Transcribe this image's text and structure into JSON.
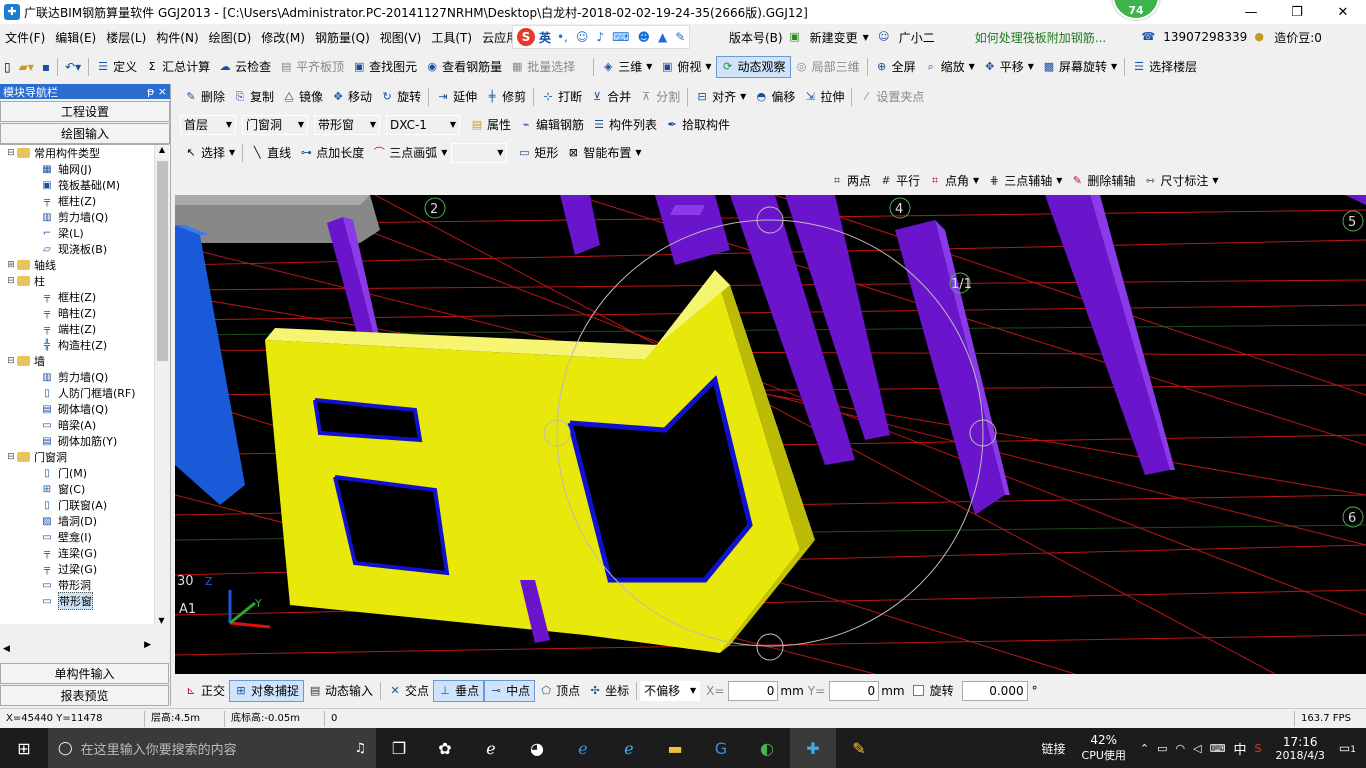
{
  "window": {
    "title": "广联达BIM钢筋算量软件 GGJ2013 - [C:\\Users\\Administrator.PC-20141127NRHM\\Desktop\\白龙村-2018-02-02-19-24-35(2666版).GGJ12]",
    "badge": "74",
    "minimize": "—",
    "restore": "❐",
    "close": "✕"
  },
  "menu": {
    "items": [
      "文件(F)",
      "编辑(E)",
      "楼层(L)",
      "构件(N)",
      "绘图(D)",
      "修改(M)",
      "钢筋量(Q)",
      "视图(V)",
      "工具(T)",
      "云应用"
    ],
    "ime_label": "英",
    "version": "版本号(B)",
    "new_change": "新建变更",
    "assistant": "广小二",
    "question": "如何处理筏板附加钢筋...",
    "phone": "13907298339",
    "price_beans": "造价豆:0"
  },
  "toolbar1": {
    "define": "定义",
    "sum": "汇总计算",
    "cloud_check": "云检查",
    "flat_top": "平齐板顶",
    "find": "查找图元",
    "view_rebar": "查看钢筋量",
    "batch_select": "批量选择",
    "three_d": "三维",
    "top_view": "俯视",
    "dynamic_view": "动态观察",
    "local_3d": "局部三维",
    "fullscreen": "全屏",
    "zoom": "缩放",
    "pan": "平移",
    "screen_rotate": "屏幕旋转",
    "select_floor": "选择楼层"
  },
  "sidebar": {
    "header": "模块导航栏",
    "pin": "ᵽ",
    "close": "×",
    "project_settings": "工程设置",
    "drawing_input": "绘图输入",
    "single_input": "单构件输入",
    "report_preview": "报表预览",
    "tree": [
      {
        "level": 0,
        "exp": "⊟",
        "icon": "folder",
        "label": "常用构件类型"
      },
      {
        "level": 1,
        "exp": "",
        "icon": "▦",
        "label": "轴网(J)"
      },
      {
        "level": 1,
        "exp": "",
        "icon": "▣",
        "label": "筏板基础(M)"
      },
      {
        "level": 1,
        "exp": "",
        "icon": "╤",
        "label": "框柱(Z)"
      },
      {
        "level": 1,
        "exp": "",
        "icon": "▥",
        "label": "剪力墙(Q)"
      },
      {
        "level": 1,
        "exp": "",
        "icon": "⌐",
        "label": "梁(L)"
      },
      {
        "level": 1,
        "exp": "",
        "icon": "▱",
        "label": "现浇板(B)"
      },
      {
        "level": 0,
        "exp": "⊞",
        "icon": "folder",
        "label": "轴线"
      },
      {
        "level": 0,
        "exp": "⊟",
        "icon": "folder",
        "label": "柱"
      },
      {
        "level": 1,
        "exp": "",
        "icon": "╤",
        "label": "框柱(Z)"
      },
      {
        "level": 1,
        "exp": "",
        "icon": "╤",
        "label": "暗柱(Z)"
      },
      {
        "level": 1,
        "exp": "",
        "icon": "╤",
        "label": "端柱(Z)"
      },
      {
        "level": 1,
        "exp": "",
        "icon": "╬",
        "label": "构造柱(Z)"
      },
      {
        "level": 0,
        "exp": "⊟",
        "icon": "folder",
        "label": "墙"
      },
      {
        "level": 1,
        "exp": "",
        "icon": "▥",
        "label": "剪力墙(Q)"
      },
      {
        "level": 1,
        "exp": "",
        "icon": "▯",
        "label": "人防门框墙(RF)"
      },
      {
        "level": 1,
        "exp": "",
        "icon": "▤",
        "label": "砌体墙(Q)"
      },
      {
        "level": 1,
        "exp": "",
        "icon": "▭",
        "label": "暗梁(A)"
      },
      {
        "level": 1,
        "exp": "",
        "icon": "▤",
        "label": "砌体加筋(Y)"
      },
      {
        "level": 0,
        "exp": "⊟",
        "icon": "folder",
        "label": "门窗洞"
      },
      {
        "level": 1,
        "exp": "",
        "icon": "▯",
        "label": "门(M)"
      },
      {
        "level": 1,
        "exp": "",
        "icon": "⊞",
        "label": "窗(C)"
      },
      {
        "level": 1,
        "exp": "",
        "icon": "▯",
        "label": "门联窗(A)"
      },
      {
        "level": 1,
        "exp": "",
        "icon": "▨",
        "label": "墙洞(D)"
      },
      {
        "level": 1,
        "exp": "",
        "icon": "▭",
        "label": "壁龛(I)"
      },
      {
        "level": 1,
        "exp": "",
        "icon": "╤",
        "label": "连梁(G)"
      },
      {
        "level": 1,
        "exp": "",
        "icon": "╤",
        "label": "过梁(G)"
      },
      {
        "level": 1,
        "exp": "",
        "icon": "▭",
        "label": "带形洞"
      },
      {
        "level": 1,
        "exp": "",
        "icon": "▭",
        "label": "带形窗",
        "selected": true
      }
    ]
  },
  "toolbar2": {
    "delete": "删除",
    "copy": "复制",
    "mirror": "镜像",
    "move": "移动",
    "rotate": "旋转",
    "extend": "延伸",
    "trim": "修剪",
    "break": "打断",
    "merge": "合并",
    "split": "分割",
    "align": "对齐",
    "offset": "偏移",
    "stretch": "拉伸",
    "set_grip": "设置夹点"
  },
  "toolbar3": {
    "floor": "首层",
    "category": "门窗洞",
    "type": "带形窗",
    "component": "DXC-1",
    "properties": "属性",
    "edit_rebar": "编辑钢筋",
    "component_list": "构件列表",
    "pick_component": "拾取构件"
  },
  "toolbar4": {
    "select": "选择",
    "line": "直线",
    "point_length": "点加长度",
    "three_point_arc": "三点画弧",
    "rect": "矩形",
    "smart_layout": "智能布置"
  },
  "toolbar5": {
    "two_points": "两点",
    "parallel": "平行",
    "point_angle": "点角",
    "three_point_axis": "三点辅轴",
    "delete_axis": "删除辅轴",
    "dimension": "尺寸标注"
  },
  "canvas": {
    "grid_labels": [
      "2",
      "4",
      "5",
      "6",
      "1/1",
      "A1",
      "30"
    ],
    "axis_z": "Z",
    "axis_y": "Y"
  },
  "snapbar": {
    "ortho": "正交",
    "object_snap": "对象捕捉",
    "dynamic_input": "动态输入",
    "intersection": "交点",
    "perpendicular": "垂点",
    "midpoint": "中点",
    "vertex": "顶点",
    "coordinate": "坐标",
    "offset_mode": "不偏移",
    "x_label": "X=",
    "x_value": "0",
    "y_label": "Y=",
    "y_value": "0",
    "mm1": "mm",
    "mm2": "mm",
    "rotate_label": "旋转",
    "rotate_value": "0.000",
    "degree": "°"
  },
  "statusbar": {
    "coords": "X=45440 Y=11478",
    "floor_height": "层高:4.5m",
    "bottom_elev": "底标高:-0.05m",
    "zero": "0",
    "fps": "163.7 FPS"
  },
  "taskbar": {
    "search_placeholder": "在这里输入你要搜索的内容",
    "link": "链接",
    "cpu_pct": "42%",
    "cpu_label": "CPU使用",
    "ime": "中",
    "time": "17:16",
    "date": "2018/4/3",
    "notif": "1"
  }
}
